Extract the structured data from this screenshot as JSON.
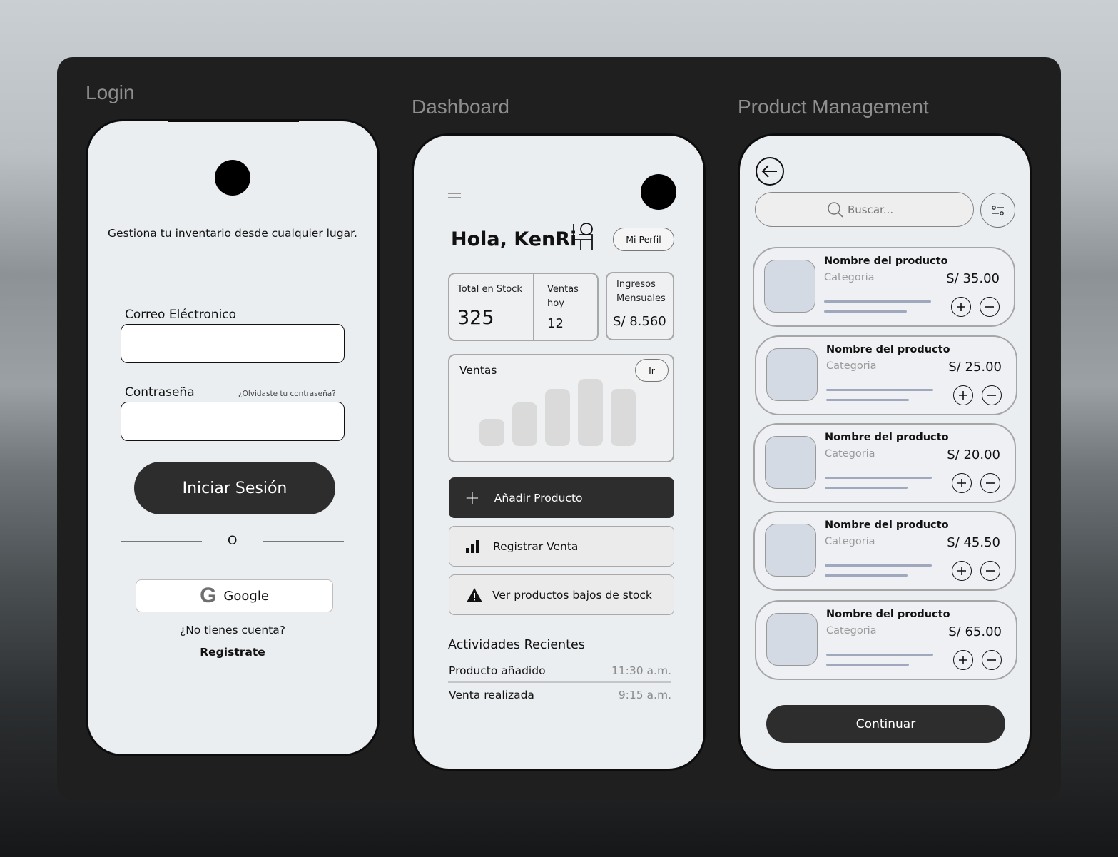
{
  "sections": {
    "login": "Login",
    "dashboard": "Dashboard",
    "products": "Product Management"
  },
  "login": {
    "tagline": "Gestiona tu inventario desde cualquier lugar.",
    "email_label": "Correo Eléctronico",
    "password_label": "Contraseña",
    "forgot_link": "¿Olvidaste tu contraseña?",
    "submit_label": "Iniciar Sesión",
    "divider_text": "O",
    "google_label": "Google",
    "no_account": "¿No tienes cuenta?",
    "register_link": "Registrate"
  },
  "dashboard": {
    "greeting": "Hola, KenRi",
    "profile_button": "Mi Perfil",
    "stats": {
      "stock_label": "Total en Stock",
      "stock_value": "325",
      "sales_today_label": "Ventas hoy",
      "sales_today_value": "12",
      "income_label": "Ingresos Mensuales",
      "income_value": "S/ 8.560"
    },
    "sales_card": {
      "title": "Ventas",
      "go_button": "Ir",
      "bars": [
        0.4,
        0.65,
        0.85,
        1.0,
        0.85
      ]
    },
    "actions": {
      "add_product": "Añadir Producto",
      "register_sale": "Registrar Venta",
      "low_stock": "Ver productos bajos de stock"
    },
    "recent": {
      "title": "Actividades Recientes",
      "items": [
        {
          "label": "Producto añadido",
          "time": "11:30 a.m."
        },
        {
          "label": "Venta realizada",
          "time": "9:15 a.m."
        }
      ]
    }
  },
  "products": {
    "search_placeholder": "Buscar...",
    "items": [
      {
        "name": "Nombre del producto",
        "category": "Categoria",
        "price": "S/ 35.00"
      },
      {
        "name": "Nombre del producto",
        "category": "Categoria",
        "price": "S/ 25.00"
      },
      {
        "name": "Nombre del producto",
        "category": "Categoria",
        "price": "S/ 20.00"
      },
      {
        "name": "Nombre del producto",
        "category": "Categoria",
        "price": "S/ 45.50"
      },
      {
        "name": "Nombre del producto",
        "category": "Categoria",
        "price": "S/ 65.00"
      }
    ],
    "continue_label": "Continuar"
  },
  "colors": {
    "board": "#1f1f1f",
    "phone": "#ebeef1",
    "primary_button": "#2d2d2d",
    "thumb": "#d4dae4",
    "progress_line": "#9fa8bd"
  },
  "icons": [
    "back-arrow-icon",
    "search-icon",
    "filter-icon",
    "plus-icon",
    "minus-icon",
    "bar-chart-icon",
    "warning-icon",
    "user-chair-icon",
    "menu-icon",
    "google-icon"
  ]
}
